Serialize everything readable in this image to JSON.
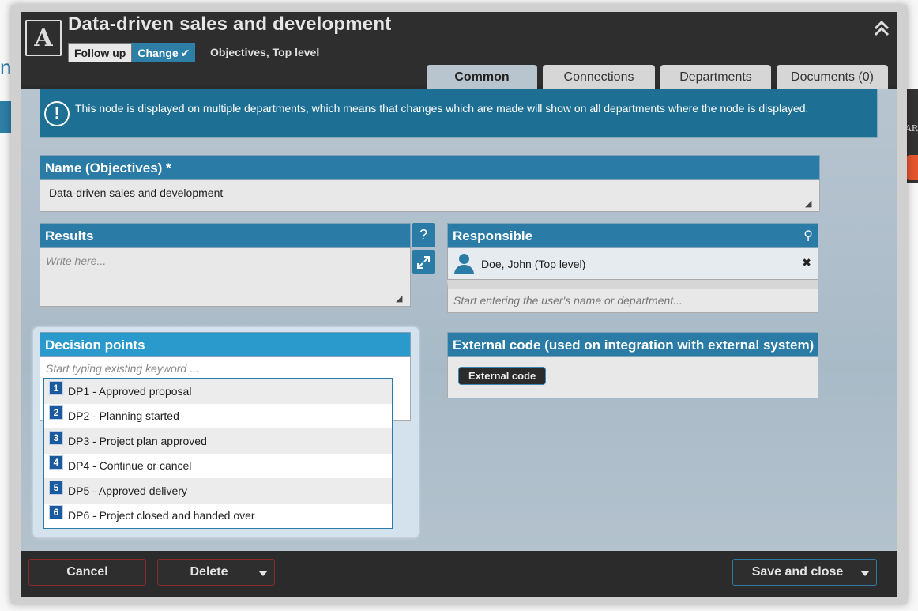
{
  "background": {
    "left_text": "np",
    "right_text": "AR"
  },
  "header": {
    "title": "Data-driven sales and development",
    "follow_up_label": "Follow up",
    "change_label": "Change",
    "subtitle": "Objectives, Top level",
    "collapse_icon": "double-chevron-up-icon"
  },
  "tabs": [
    {
      "label": "Common",
      "active": true
    },
    {
      "label": "Connections",
      "active": false
    },
    {
      "label": "Departments",
      "active": false
    },
    {
      "label": "Documents (0)",
      "active": false
    }
  ],
  "notice": {
    "icon": "exclamation-circle-icon",
    "text": "This node is displayed on multiple departments, which means that changes which are made will show on all departments where the node is displayed."
  },
  "name_field": {
    "label": "Name (Objectives) *",
    "value": "Data-driven sales and development"
  },
  "results_field": {
    "label": "Results",
    "placeholder": "Write here...",
    "help_label": "?"
  },
  "responsible_field": {
    "label": "Responsible",
    "person": "Doe, John (Top level)",
    "remove_label": "✖",
    "placeholder": "Start entering the user's name or department..."
  },
  "decision_points": {
    "label": "Decision points",
    "placeholder": "Start typing existing keyword ...",
    "options": [
      {
        "num": "1",
        "label": "DP1 - Approved proposal"
      },
      {
        "num": "2",
        "label": "DP2 - Planning started"
      },
      {
        "num": "3",
        "label": "DP3 - Project plan approved"
      },
      {
        "num": "4",
        "label": "DP4 - Continue or cancel"
      },
      {
        "num": "5",
        "label": "DP5 - Approved delivery"
      },
      {
        "num": "6",
        "label": "DP6 - Project closed and handed over"
      }
    ]
  },
  "external_code": {
    "label": "External code (used on integration with external system)",
    "tag": "External code"
  },
  "footer": {
    "cancel_label": "Cancel",
    "delete_label": "Delete",
    "save_label": "Save and close"
  },
  "colors": {
    "accent": "#2a7ca6",
    "header_bg": "#2e2e2e",
    "danger_border": "#8a2a2a"
  }
}
